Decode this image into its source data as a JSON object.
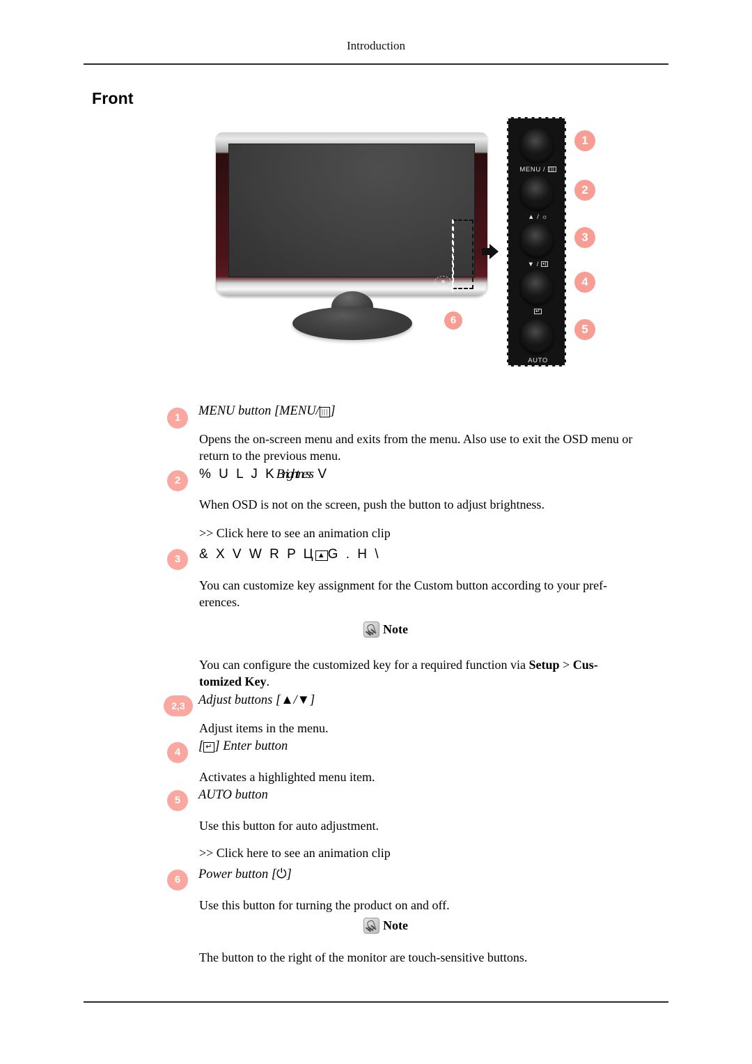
{
  "header": {
    "running_head": "Introduction"
  },
  "section": {
    "title": "Front"
  },
  "figure": {
    "panel_labels": {
      "menu": "MENU /",
      "up": "▲ /",
      "down": "▼ /",
      "enter": "",
      "auto": "AUTO"
    },
    "badges": [
      "1",
      "2",
      "3",
      "4",
      "5"
    ],
    "monitor_badge": "6"
  },
  "items": [
    {
      "num": "1",
      "heading": "MENU button [MENU/",
      "heading_tail": "]",
      "body": "Opens the on-screen menu and exits from the menu. Also use to exit the OSD menu or return to the previous menu."
    },
    {
      "num": "2",
      "heading_garbled_a": "% U L J K",
      "heading_garbled_b": "Brightness",
      "heading_garbled_c": "V",
      "body": "When OSD is not on the screen, push the button to adjust brightness.",
      "link": ">> Click here to see an animation clip"
    },
    {
      "num": "3",
      "heading_garbled_a": "& X V W R P Ц",
      "heading_garbled_b": "G",
      "heading_garbled_c": ". H \\",
      "body": "You can customize key assignment for the Custom button according to your pref-erences.",
      "note_label": "Note",
      "note_body_1": "You can configure the customized key for a required function via ",
      "note_bold_1": "Setup",
      "note_body_2": " > ",
      "note_bold_2": "Cus-",
      "note_bold_3": "tomized Key",
      "note_body_3": "."
    },
    {
      "num": "2,3",
      "heading": "Adjust buttons [▲/▼]",
      "body": "Adjust items in the menu."
    },
    {
      "num": "4",
      "heading_pre": "[",
      "heading_post": "] Enter button",
      "body": "Activates a highlighted menu item."
    },
    {
      "num": "5",
      "heading": "AUTO button",
      "body": "Use this button for auto adjustment.",
      "link": ">> Click here to see an animation clip"
    },
    {
      "num": "6",
      "heading_pre": "Power button [",
      "heading_post": "]",
      "body": "Use this button for turning the product on and off.",
      "note_label": "Note",
      "note_body": "The button to the right of the monitor are touch-sensitive buttons."
    }
  ],
  "colors": {
    "badge_figure": "#f79d94",
    "badge_list": "#f9a79f",
    "rule": "#2a2a2a"
  }
}
